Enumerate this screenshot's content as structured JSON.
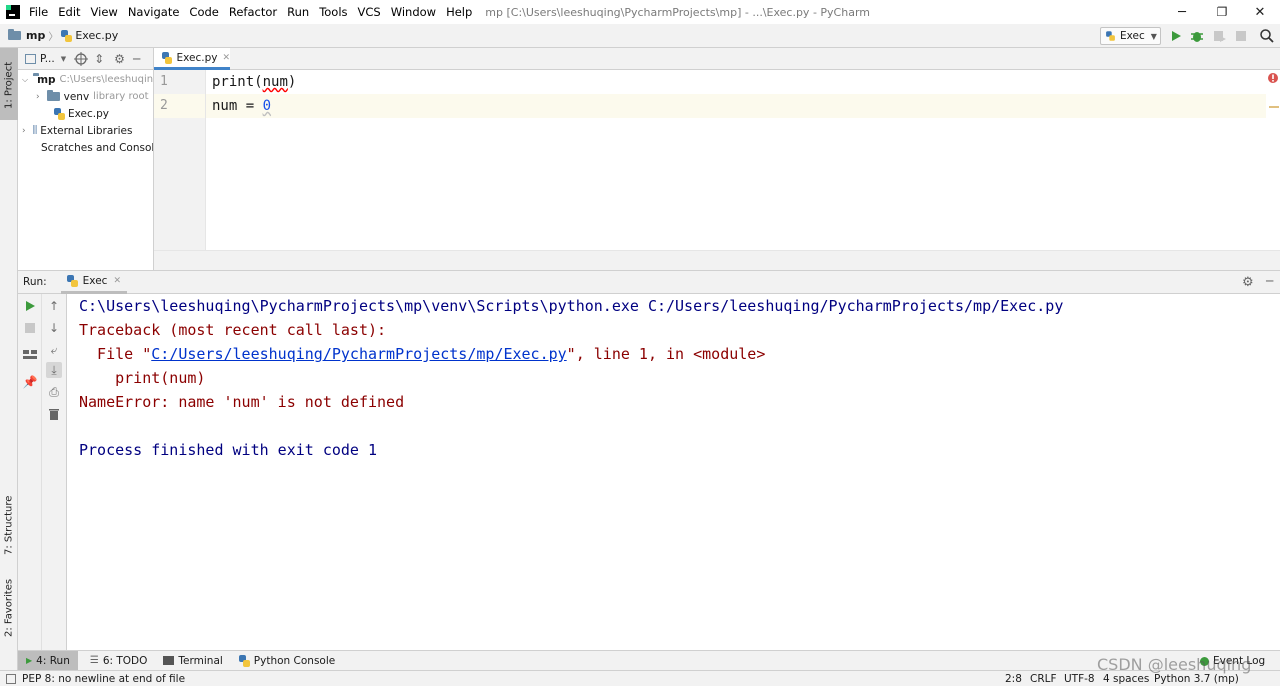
{
  "menubar": {
    "items": [
      "File",
      "Edit",
      "View",
      "Navigate",
      "Code",
      "Refactor",
      "Run",
      "Tools",
      "VCS",
      "Window",
      "Help"
    ],
    "window_title": "mp [C:\\Users\\leeshuqing\\PycharmProjects\\mp] - ...\\Exec.py - PyCharm",
    "minimize": "─",
    "maximize": "❐",
    "close": "✕"
  },
  "navbar": {
    "project": "mp",
    "separator": "〉",
    "file": "Exec.py",
    "run_config": "Exec"
  },
  "sidebar": {
    "project_tab": "1: Project",
    "structure_tab": "7: Structure",
    "favorites_tab": "2: Favorites"
  },
  "project_panel": {
    "title": "P...",
    "tree": [
      {
        "name": "mp",
        "hint": "C:\\Users\\leeshuqing"
      },
      {
        "name": "venv",
        "hint": "library root"
      },
      {
        "name": "Exec.py",
        "hint": ""
      },
      {
        "name": "External Libraries",
        "hint": ""
      },
      {
        "name": "Scratches and Consoles",
        "hint": ""
      }
    ]
  },
  "editor": {
    "tab_label": "Exec.py",
    "line_numbers": [
      "1",
      "2"
    ],
    "line1": {
      "fn": "print",
      "open": "(",
      "var": "num",
      "close": ")"
    },
    "line2": {
      "lhs": "num = ",
      "num": "0"
    }
  },
  "run_panel": {
    "label": "Run:",
    "tab_label": "Exec",
    "console": {
      "command": "C:\\Users\\leeshuqing\\PycharmProjects\\mp\\venv\\Scripts\\python.exe C:/Users/leeshuqing/PycharmProjects/mp/Exec.py",
      "traceback": "Traceback (most recent call last):",
      "file_prefix": "  File \"",
      "file_link": "C:/Users/leeshuqing/PycharmProjects/mp/Exec.py",
      "file_suffix": "\", line 1, in <module>",
      "code": "    print(num)",
      "error": "NameError: name 'num' is not defined",
      "finished": "Process finished with exit code 1"
    }
  },
  "bottom_tabs": {
    "run": "4: Run",
    "todo": "6: TODO",
    "terminal": "Terminal",
    "python_console": "Python Console",
    "event_log": "Event Log"
  },
  "statusbar": {
    "message": "PEP 8: no newline at end of file",
    "position": "2:8",
    "line_sep": "CRLF",
    "encoding": "UTF-8",
    "indent": "4 spaces",
    "interpreter": "Python 3.7 (mp)"
  },
  "watermark": "CSDN @leeshuqing",
  "colors": {
    "console_blue": "#000080",
    "error_red": "#8b0000",
    "link": "#0033cc",
    "number": "#1750eb",
    "run_green": "#3c9a3c",
    "highlight_line": "#fcfaed"
  }
}
